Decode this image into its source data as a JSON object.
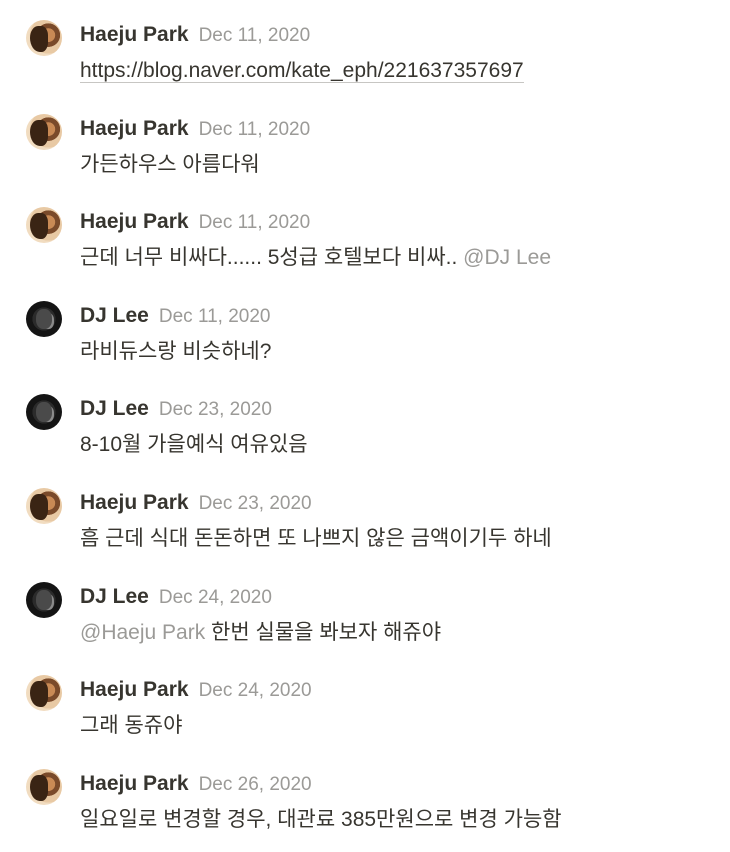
{
  "comments": [
    {
      "author": "Haeju Park",
      "date": "Dec 11, 2020",
      "avatar": "haeju-avatar",
      "link": "https://blog.naver.com/kate_eph/221637357697"
    },
    {
      "author": "Haeju Park",
      "date": "Dec 11, 2020",
      "avatar": "haeju-avatar",
      "text": "가든하우스 아름다워"
    },
    {
      "author": "Haeju Park",
      "date": "Dec 11, 2020",
      "avatar": "haeju-avatar",
      "text": "근데 너무 비싸다...... 5성급 호텔보다 비싸..",
      "mention_after": "@DJ Lee"
    },
    {
      "author": "DJ Lee",
      "date": "Dec 11, 2020",
      "avatar": "dj-avatar",
      "text": "라비듀스랑 비슷하네?"
    },
    {
      "author": "DJ Lee",
      "date": "Dec 23, 2020",
      "avatar": "dj-avatar",
      "text": "8-10월 가을예식 여유있음"
    },
    {
      "author": "Haeju Park",
      "date": "Dec 23, 2020",
      "avatar": "haeju-avatar",
      "text": "흠 근데 식대 돈돈하면 또 나쁘지 않은 금액이기두 하네"
    },
    {
      "author": "DJ Lee",
      "date": "Dec 24, 2020",
      "avatar": "dj-avatar",
      "mention_before": "@Haeju Park",
      "text": "한번 실물을 봐보자 해쥬야"
    },
    {
      "author": "Haeju Park",
      "date": "Dec 24, 2020",
      "avatar": "haeju-avatar",
      "text": "그래 동쥬야"
    },
    {
      "author": "Haeju Park",
      "date": "Dec 26, 2020",
      "avatar": "haeju-avatar",
      "text": "일요일로 변경할 경우, 대관료 385만원으로 변경 가능함"
    }
  ]
}
